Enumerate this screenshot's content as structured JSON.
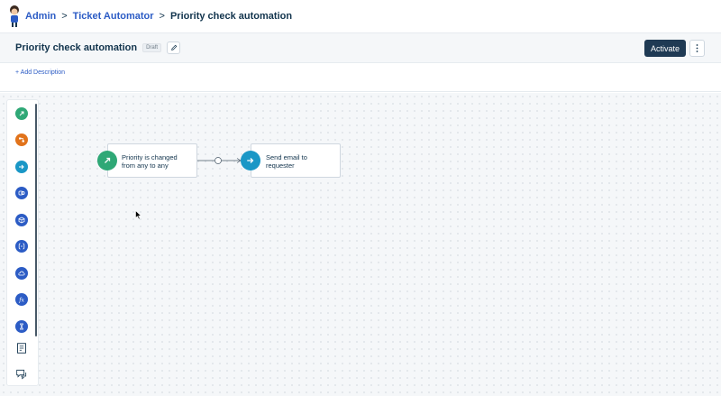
{
  "breadcrumb": {
    "items": [
      {
        "label": "Admin"
      },
      {
        "label": "Ticket Automator"
      },
      {
        "label": "Priority check automation"
      }
    ],
    "separator": ">"
  },
  "header": {
    "title": "Priority check automation",
    "status_badge": "Draft",
    "activate_label": "Activate",
    "more_icon": "vertical-dots-icon",
    "edit_icon": "pencil-icon"
  },
  "description": {
    "add_label": "+ Add Description"
  },
  "palette": {
    "items": [
      {
        "name": "event-trigger-icon",
        "color": "#2fa876"
      },
      {
        "name": "condition-icon",
        "color": "#e1731b"
      },
      {
        "name": "action-icon",
        "color": "#1a97c6"
      },
      {
        "name": "app-action-icon",
        "color": "#2c5cc5"
      },
      {
        "name": "cube-icon",
        "color": "#2c5cc5"
      },
      {
        "name": "json-parser-icon",
        "color": "#2c5cc5"
      },
      {
        "name": "cloud-icon",
        "color": "#2c5cc5"
      },
      {
        "name": "function-icon",
        "color": "#2c5cc5"
      },
      {
        "name": "timer-icon",
        "color": "#2c5cc5"
      },
      {
        "name": "template-icon",
        "color": "#12344d"
      },
      {
        "name": "chat-icon",
        "color": "#12344d"
      }
    ]
  },
  "workflow": {
    "trigger_node": {
      "text_line1": "Priority is changed",
      "text_line2": "from any to any",
      "icon": "arrow-trigger-icon",
      "color": "#2fa876"
    },
    "action_node": {
      "text_line1": "Send email to",
      "text_line2": "requester",
      "icon": "send-arrow-icon",
      "color": "#1a97c6"
    }
  },
  "colors": {
    "primary_button": "#1f3a54",
    "link": "#2c5cc5",
    "text": "#12344d"
  }
}
